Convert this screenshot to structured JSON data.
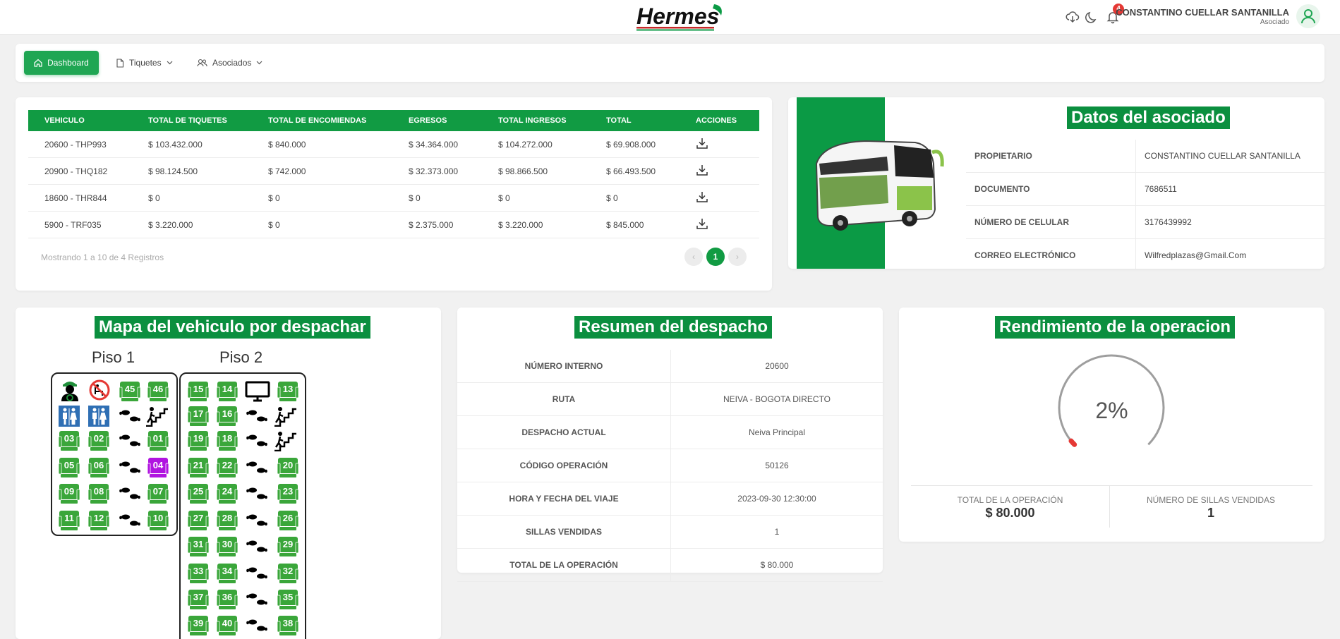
{
  "header": {
    "logo_text": "Hermes",
    "notifications_count": "4",
    "user_name": "CONSTANTINO CUELLAR SANTANILLA",
    "user_role": "Asociado",
    "icons": [
      "cloud-download-icon",
      "moon-icon",
      "bell-icon",
      "user-avatar-icon"
    ]
  },
  "nav": {
    "dashboard": "Dashboard",
    "tiquetes": "Tiquetes",
    "asociados": "Asociados"
  },
  "vehicles_table": {
    "columns": [
      "VEHICULO",
      "TOTAL DE TIQUETES",
      "TOTAL DE ENCOMIENDAS",
      "EGRESOS",
      "TOTAL INGRESOS",
      "TOTAL",
      "ACCIONES"
    ],
    "rows": [
      [
        "20600 - THP993",
        "$ 103.432.000",
        "$ 840.000",
        "$ 34.364.000",
        "$ 104.272.000",
        "$ 69.908.000"
      ],
      [
        "20900 - THQ182",
        "$ 98.124.500",
        "$ 742.000",
        "$ 32.373.000",
        "$ 98.866.500",
        "$ 66.493.500"
      ],
      [
        "18600 - THR844",
        "$ 0",
        "$ 0",
        "$ 0",
        "$ 0",
        "$ 0"
      ],
      [
        "5900 - TRF035",
        "$ 3.220.000",
        "$ 0",
        "$ 2.375.000",
        "$ 3.220.000",
        "$ 845.000"
      ]
    ],
    "info": "Mostrando 1 a 10 de 4 Registros",
    "pagination": {
      "prev": "‹",
      "current": "1",
      "next": "›"
    }
  },
  "associate": {
    "title": "Datos del asociado",
    "fields": [
      {
        "label": "PROPIETARIO",
        "value": "CONSTANTINO CUELLAR SANTANILLA"
      },
      {
        "label": "DOCUMENTO",
        "value": "7686511"
      },
      {
        "label": "NÚMERO DE CELULAR",
        "value": "3176439992"
      },
      {
        "label": "CORREO ELECTRÓNICO",
        "value": "Wilfredplazas@Gmail.Com"
      }
    ]
  },
  "vehicle_map": {
    "title": "Mapa del vehiculo por despachar",
    "floor1_label": "Piso 1",
    "floor2_label": "Piso 2",
    "floor1_seats": [
      "45",
      "46",
      "03",
      "02",
      "01",
      "05",
      "06",
      "04",
      "09",
      "08",
      "07",
      "11",
      "12",
      "10"
    ],
    "floor1_selected_seat": "04",
    "floor2_seats": [
      "15",
      "14",
      "13",
      "17",
      "16",
      "19",
      "18",
      "21",
      "22",
      "20",
      "25",
      "24",
      "23",
      "27",
      "28",
      "26",
      "31",
      "30",
      "29",
      "33",
      "34",
      "32",
      "37",
      "36",
      "35",
      "39",
      "40",
      "38"
    ],
    "colors": {
      "seat": "#3aa63a",
      "selected_seat": "#b014e0"
    }
  },
  "dispatch_summary": {
    "title": "Resumen del despacho",
    "rows": [
      {
        "label": "NÚMERO INTERNO",
        "value": "20600"
      },
      {
        "label": "RUTA",
        "value": "NEIVA - BOGOTA DIRECTO"
      },
      {
        "label": "DESPACHO ACTUAL",
        "value": "Neiva Principal"
      },
      {
        "label": "CÓDIGO OPERACIÓN",
        "value": "50126"
      },
      {
        "label": "HORA Y FECHA DEL VIAJE",
        "value": "2023-09-30 12:30:00"
      },
      {
        "label": "SILLAS VENDIDAS",
        "value": "1"
      },
      {
        "label": "TOTAL DE LA OPERACIÓN",
        "value": "$ 80.000"
      }
    ]
  },
  "performance": {
    "title": "Rendimiento de la operacion",
    "percent_label": "2%",
    "percent_value": 2,
    "total_label": "TOTAL DE LA OPERACIÓN",
    "total_value": "$ 80.000",
    "seats_label": "NÚMERO DE SILLAS VENDIDAS",
    "seats_value": "1"
  },
  "theme": {
    "primary": "#119b43",
    "primary_light": "#1fa653",
    "danger": "#e53935"
  }
}
